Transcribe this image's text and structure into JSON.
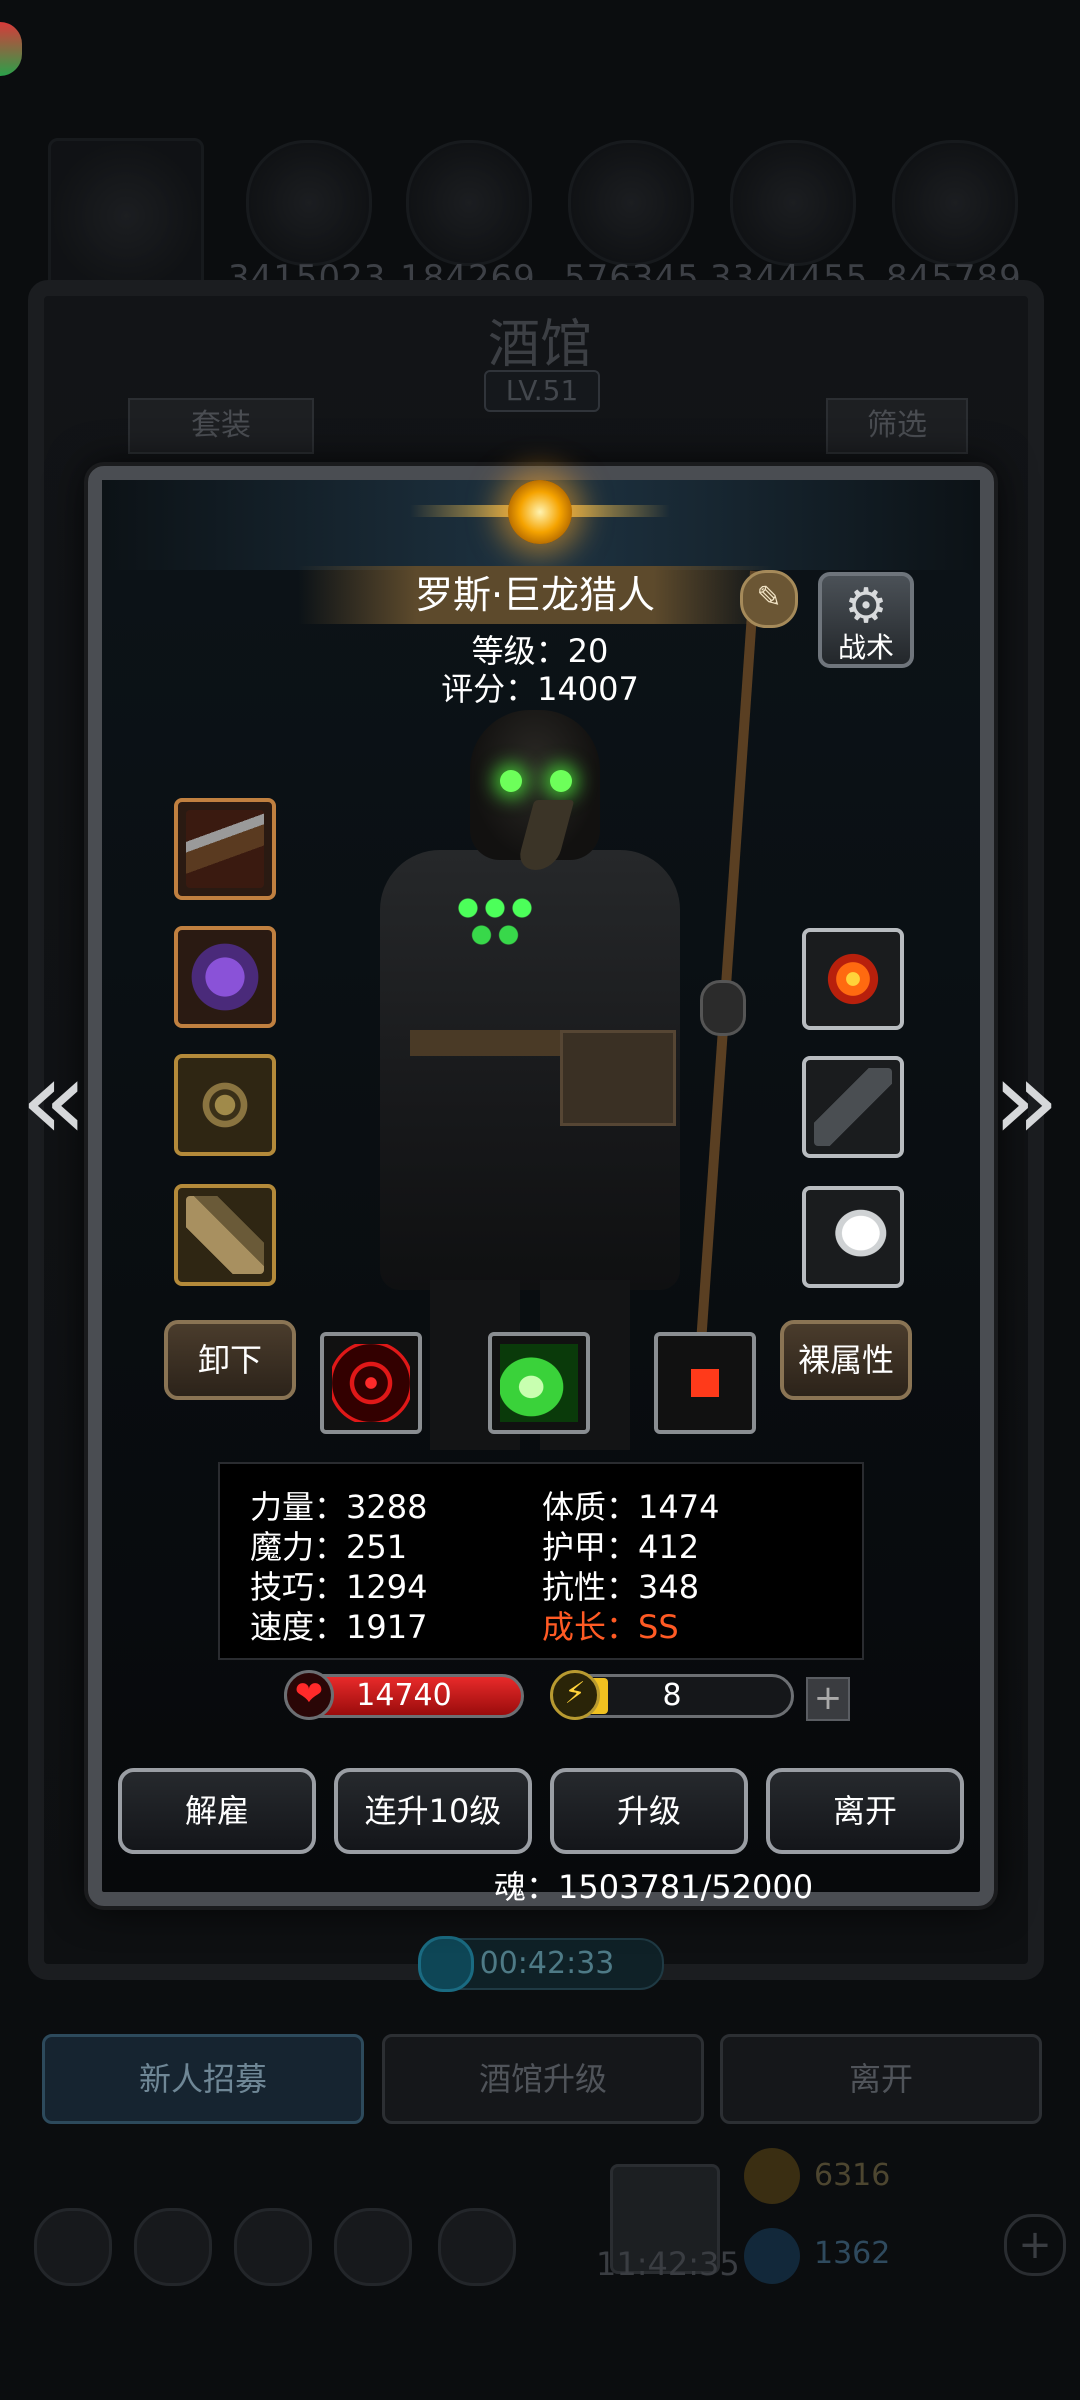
{
  "background": {
    "resource_values": [
      "3415023",
      "184269",
      "576345",
      "3344455",
      "845789"
    ],
    "tavern_title": "酒馆",
    "tavern_level": "LV.51",
    "tab_set": "套装",
    "tab_filter": "筛选",
    "timer": "00:42:33",
    "bottom_tabs": [
      {
        "label": "新人招募",
        "active": true
      },
      {
        "label": "酒馆升级",
        "active": false
      },
      {
        "label": "离开",
        "active": false
      }
    ],
    "clock": "11:42:35",
    "currency_gold": "6316",
    "currency_blue": "1362"
  },
  "hero": {
    "name": "罗斯·巨龙猎人",
    "level_label": "等级：20",
    "score_label": "评分：14007",
    "edit_icon": "✎",
    "tactics_label": "战术",
    "tactics_icon": "⚙"
  },
  "equipment": {
    "left": [
      "musket-icon",
      "purple-armor-icon",
      "compass-amulet-icon",
      "gauntlet-icon"
    ],
    "right": [
      "fire-orb-icon",
      "claw-icon",
      "wing-icon"
    ]
  },
  "buttons": {
    "unequip": "卸下",
    "base_attributes": "裸属性",
    "dismiss": "解雇",
    "level_up_10": "连升10级",
    "level_up": "升级",
    "leave": "离开",
    "prev_arrow": "«",
    "next_arrow": "»",
    "plus": "+"
  },
  "skills": [
    "target-skill-icon",
    "poison-skill-icon",
    "heal-cross-skill-icon"
  ],
  "stats": {
    "strength": "力量：3288",
    "magic": "魔力：251",
    "skill": "技巧：1294",
    "speed": "速度：1917",
    "constitution": "体质：1474",
    "armor": "护甲：412",
    "resistance": "抗性：348",
    "growth": "成长：SS"
  },
  "vitals": {
    "hp": "14740",
    "energy": "8",
    "heart_glyph": "❤",
    "bolt_glyph": "⚡"
  },
  "soul": "魂：1503781/52000",
  "colors": {
    "growth": "#ff5a24",
    "hp": "#e82a2a",
    "poison_glow": "#4cff5a"
  }
}
